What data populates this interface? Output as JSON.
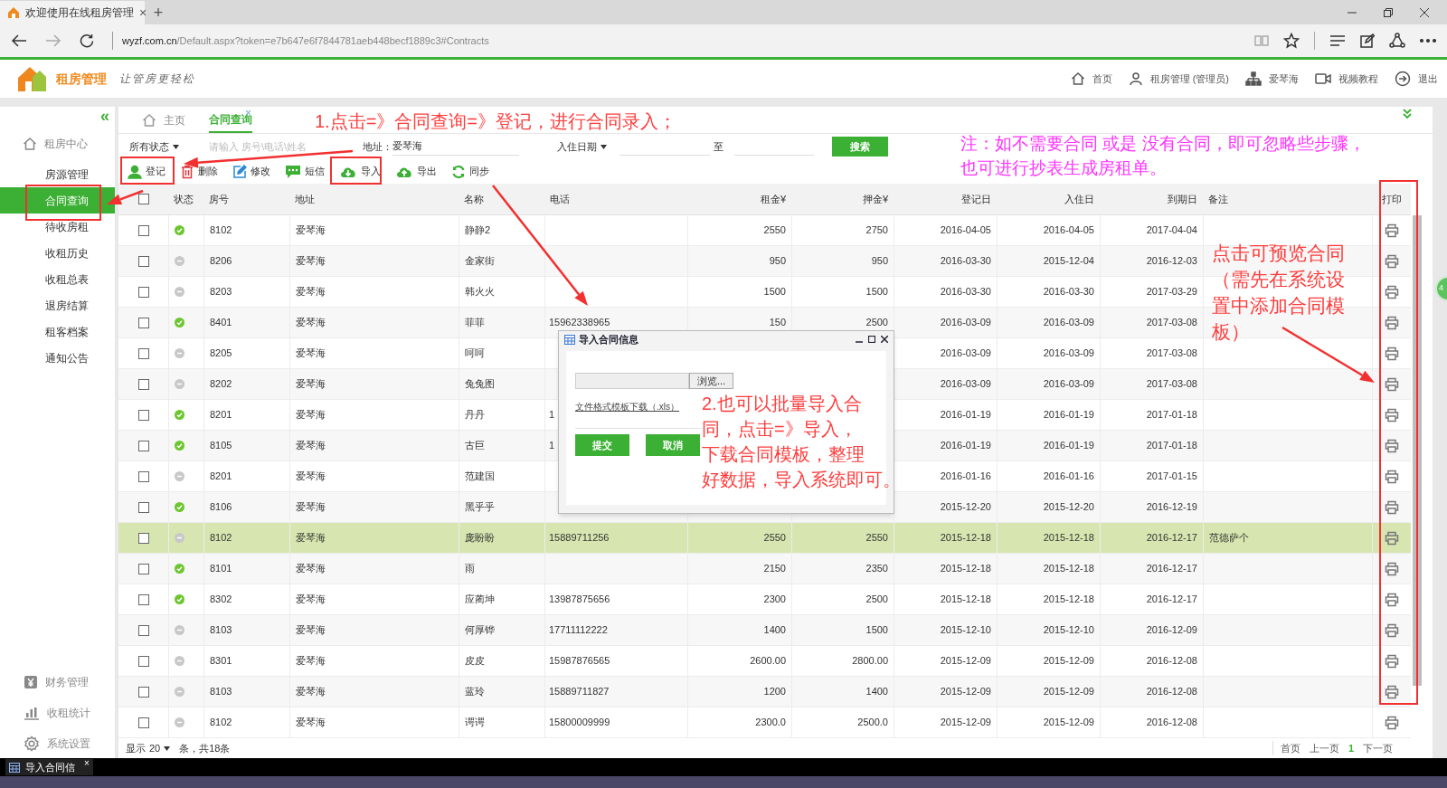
{
  "browser": {
    "tab_title": "欢迎使用在线租房管理",
    "tab_close": "×",
    "new_tab": "+",
    "url_domain": "wyzf.com.cn",
    "url_path": "/Default.aspx?token=e7b647e6f7844781aeb448becf1889c3#Contracts"
  },
  "header": {
    "app_name": "租房管理",
    "slogan": "让管房更轻松",
    "nav": [
      {
        "label": "首页"
      },
      {
        "label": "租房管理 (管理员)"
      },
      {
        "label": "爱琴海"
      },
      {
        "label": "视频教程"
      },
      {
        "label": "退出"
      }
    ]
  },
  "sidebar": {
    "collapse": "«",
    "section": "租房中心",
    "items": [
      {
        "label": "房源管理",
        "selected": false
      },
      {
        "label": "合同查询",
        "selected": true
      },
      {
        "label": "待收房租",
        "selected": false
      },
      {
        "label": "收租历史",
        "selected": false
      },
      {
        "label": "收租总表",
        "selected": false
      },
      {
        "label": "退房结算",
        "selected": false
      },
      {
        "label": "租客档案",
        "selected": false
      },
      {
        "label": "通知公告",
        "selected": false
      }
    ],
    "bottom_items": [
      {
        "label": "财务管理"
      },
      {
        "label": "收租统计"
      },
      {
        "label": "系统设置"
      }
    ]
  },
  "tabs": [
    {
      "label": "主页",
      "selected": false
    },
    {
      "label": "合同查询",
      "selected": true,
      "close": "×"
    }
  ],
  "filter": {
    "status_select": "所有状态",
    "search_placeholder": "请输入 房号\\电话\\姓名",
    "address_label": "地址：",
    "address_value": "爱琴海",
    "date_select": "入住日期",
    "to_label": "至",
    "search_button": "搜索"
  },
  "toolbar": [
    {
      "label": "登记"
    },
    {
      "label": "删除"
    },
    {
      "label": "修改"
    },
    {
      "label": "短信"
    },
    {
      "label": "导入"
    },
    {
      "label": "导出"
    },
    {
      "label": "同步"
    }
  ],
  "table": {
    "header_checked": false,
    "columns": [
      "状态",
      "房号",
      "地址",
      "名称",
      "电话",
      "租金¥",
      "押金¥",
      "登记日",
      "入住日",
      "到期日",
      "备注",
      "打印"
    ],
    "rows": [
      {
        "checked": false,
        "active": true,
        "selected": false,
        "room": "8102",
        "address": "爱琴海",
        "name": "静静2",
        "phone": "",
        "rent": "2550",
        "deposit": "2750",
        "registered": "2016-04-05",
        "check_in": "2016-04-05",
        "due": "2017-04-04",
        "note": ""
      },
      {
        "checked": false,
        "active": false,
        "selected": false,
        "room": "8206",
        "address": "爱琴海",
        "name": "金家街",
        "phone": "",
        "rent": "950",
        "deposit": "950",
        "registered": "2016-03-30",
        "check_in": "2015-12-04",
        "due": "2016-12-03",
        "note": ""
      },
      {
        "checked": false,
        "active": false,
        "selected": false,
        "room": "8203",
        "address": "爱琴海",
        "name": "韩火火",
        "phone": "",
        "rent": "1500",
        "deposit": "1500",
        "registered": "2016-03-30",
        "check_in": "2016-03-30",
        "due": "2017-03-29",
        "note": ""
      },
      {
        "checked": false,
        "active": true,
        "selected": false,
        "room": "8401",
        "address": "爱琴海",
        "name": "菲菲",
        "phone": "15962338965",
        "rent": "150",
        "deposit": "2500",
        "registered": "2016-03-09",
        "check_in": "2016-03-09",
        "due": "2017-03-08",
        "note": ""
      },
      {
        "checked": false,
        "active": false,
        "selected": false,
        "room": "8205",
        "address": "爱琴海",
        "name": "呵呵",
        "phone": "",
        "rent": "",
        "deposit": "",
        "registered": "2016-03-09",
        "check_in": "2016-03-09",
        "due": "2017-03-08",
        "note": ""
      },
      {
        "checked": false,
        "active": false,
        "selected": false,
        "room": "8202",
        "address": "爱琴海",
        "name": "兔兔图",
        "phone": "",
        "rent": "",
        "deposit": "",
        "registered": "2016-03-09",
        "check_in": "2016-03-09",
        "due": "2017-03-08",
        "note": ""
      },
      {
        "checked": false,
        "active": true,
        "selected": false,
        "room": "8201",
        "address": "爱琴海",
        "name": "丹丹",
        "phone": "1",
        "rent": "",
        "deposit": "",
        "registered": "2016-01-19",
        "check_in": "2016-01-19",
        "due": "2017-01-18",
        "note": ""
      },
      {
        "checked": false,
        "active": true,
        "selected": false,
        "room": "8105",
        "address": "爱琴海",
        "name": "古巨",
        "phone": "1",
        "rent": "",
        "deposit": "",
        "registered": "2016-01-19",
        "check_in": "2016-01-19",
        "due": "2017-01-18",
        "note": ""
      },
      {
        "checked": false,
        "active": false,
        "selected": false,
        "room": "8201",
        "address": "爱琴海",
        "name": "范建国",
        "phone": "",
        "rent": "",
        "deposit": "",
        "registered": "2016-01-16",
        "check_in": "2016-01-16",
        "due": "2017-01-15",
        "note": ""
      },
      {
        "checked": false,
        "active": true,
        "selected": false,
        "room": "8106",
        "address": "爱琴海",
        "name": "黑乎乎",
        "phone": "",
        "rent": "",
        "deposit": "",
        "registered": "2015-12-20",
        "check_in": "2015-12-20",
        "due": "2016-12-19",
        "note": ""
      },
      {
        "checked": false,
        "active": false,
        "selected": true,
        "room": "8102",
        "address": "爱琴海",
        "name": "庞盼盼",
        "phone": "15889711256",
        "rent": "2550",
        "deposit": "2550",
        "registered": "2015-12-18",
        "check_in": "2015-12-18",
        "due": "2016-12-17",
        "note": "范德萨个"
      },
      {
        "checked": false,
        "active": true,
        "selected": false,
        "room": "8101",
        "address": "爱琴海",
        "name": "雨",
        "phone": "",
        "rent": "2150",
        "deposit": "2350",
        "registered": "2015-12-18",
        "check_in": "2015-12-18",
        "due": "2016-12-17",
        "note": ""
      },
      {
        "checked": false,
        "active": true,
        "selected": false,
        "room": "8302",
        "address": "爱琴海",
        "name": "应蔺坤",
        "phone": "13987875656",
        "rent": "2300",
        "deposit": "2500",
        "registered": "2015-12-18",
        "check_in": "2015-12-18",
        "due": "2016-12-17",
        "note": ""
      },
      {
        "checked": false,
        "active": false,
        "selected": false,
        "room": "8103",
        "address": "爱琴海",
        "name": "何厚铧",
        "phone": "17711112222",
        "rent": "1400",
        "deposit": "1500",
        "registered": "2015-12-10",
        "check_in": "2015-12-10",
        "due": "2016-12-09",
        "note": ""
      },
      {
        "checked": false,
        "active": false,
        "selected": false,
        "room": "8301",
        "address": "爱琴海",
        "name": "皮皮",
        "phone": "15987876565",
        "rent": "2600.00",
        "deposit": "2800.00",
        "registered": "2015-12-09",
        "check_in": "2015-12-09",
        "due": "2016-12-08",
        "note": ""
      },
      {
        "checked": false,
        "active": false,
        "selected": false,
        "room": "8103",
        "address": "爱琴海",
        "name": "蓝玲",
        "phone": "15889711827",
        "rent": "1200",
        "deposit": "1400",
        "registered": "2015-12-09",
        "check_in": "2015-12-09",
        "due": "2016-12-08",
        "note": ""
      },
      {
        "checked": false,
        "active": false,
        "selected": false,
        "room": "8102",
        "address": "爱琴海",
        "name": "谔谔",
        "phone": "15800009999",
        "rent": "2300.0",
        "deposit": "2500.0",
        "registered": "2015-12-09",
        "check_in": "2015-12-09",
        "due": "2016-12-08",
        "note": ""
      }
    ]
  },
  "footer": {
    "show_label": "显示",
    "page_size": "20",
    "summary": "条，共18条",
    "pager": [
      {
        "label": "首页",
        "selected": false
      },
      {
        "label": "上一页",
        "selected": false
      },
      {
        "label": "1",
        "selected": true
      },
      {
        "label": "下一页",
        "selected": false
      }
    ]
  },
  "dialog": {
    "title": "导入合同信息",
    "browse_button": "浏览...",
    "template_link": "文件格式模板下载（.xls）",
    "submit_button": "提交",
    "cancel_button": "取消"
  },
  "taskbar": {
    "label": "导入合同信",
    "close": "×"
  },
  "side_badge": "4",
  "annotations": [
    {
      "lines": [
        "1.点击=》合同查询=》登记，进行合同录入；"
      ],
      "color": "#ff3b3b"
    },
    {
      "lines": [
        "注：如不需要合同 或是 没有合同，即可忽略些步骤，",
        "也可进行抄表生成房租单。"
      ],
      "color": "#ff33ff"
    },
    {
      "lines": [
        "2.也可以批量导入合",
        "同，点击=》导入，",
        "下载合同模板，整理",
        "好数据，导入系统即可。"
      ],
      "color": "#ff3b3b"
    },
    {
      "lines": [
        "点击可预览合同",
        "（需先在系统设",
        "置中添加合同模",
        "板）"
      ],
      "color": "#ff3b3b"
    }
  ]
}
